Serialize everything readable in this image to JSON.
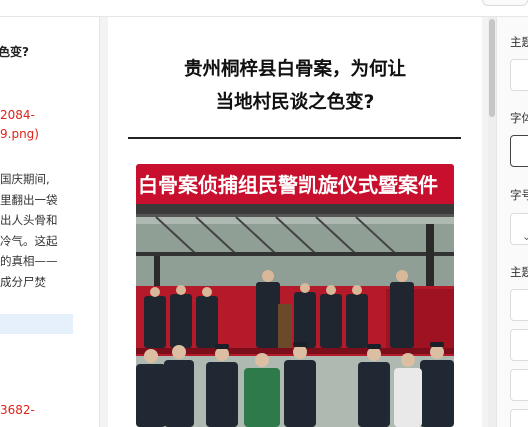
{
  "left_panel": {
    "question_tail": "色变?",
    "image_ref_1_line1": "2084-",
    "image_ref_1_line2": "9.png)",
    "paragraph_lines": [
      "国庆期间,",
      "里翻出一袋",
      "出人头骨和",
      "冷气。这起",
      "的真相——",
      "成分尸焚"
    ],
    "image_ref_2_line1": "3682-",
    "image_ref_2_line2": "-"
  },
  "article": {
    "title_line1": "贵州桐梓县白骨案，为何让",
    "title_line2": "当地村民谈之色变?",
    "banner_text": "白骨案侦捕组民警凯旋仪式暨案件",
    "photo_icon": "photo-press-event"
  },
  "right_panel": {
    "label_theme": "主题",
    "label_font": "字体",
    "label_size": "字号",
    "label_theme2": "主题"
  },
  "colors": {
    "accent_red": "#e0231a",
    "highlight_blue": "#e6f0fc",
    "banner_red": "#c8102e"
  }
}
